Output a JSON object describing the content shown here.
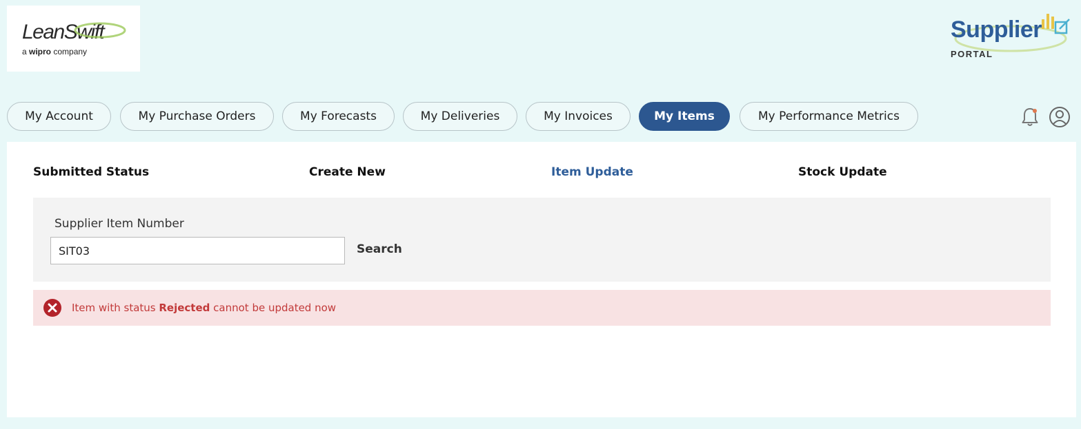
{
  "brand": {
    "logo_text": "LeanSwift",
    "logo_sub_prefix": "a ",
    "logo_sub_bold": "wipro",
    "logo_sub_suffix": " company",
    "portal_title": "Supplier",
    "portal_sub": "PORTAL"
  },
  "nav": {
    "tabs": [
      {
        "label": "My Account"
      },
      {
        "label": "My Purchase Orders"
      },
      {
        "label": "My Forecasts"
      },
      {
        "label": "My Deliveries"
      },
      {
        "label": "My Invoices"
      },
      {
        "label": "My Items",
        "active": true
      },
      {
        "label": "My Performance Metrics"
      }
    ]
  },
  "icons": {
    "notification": "bell-icon",
    "notification_dot_color": "#e07a4f",
    "user": "user-circle-icon"
  },
  "subtabs": [
    {
      "label": "Submitted Status"
    },
    {
      "label": "Create New"
    },
    {
      "label": "Item Update",
      "active": true
    },
    {
      "label": "Stock Update"
    }
  ],
  "search": {
    "label": "Supplier Item Number",
    "value": "SIT03",
    "button": "Search"
  },
  "alert": {
    "prefix": "Item with status ",
    "status": "Rejected",
    "suffix": " cannot be updated now",
    "icon": "error-circle-icon"
  },
  "colors": {
    "accent": "#2c5790",
    "background": "#e8f8f8",
    "error_text": "#c23a3a",
    "error_bg": "#f8e2e3"
  }
}
